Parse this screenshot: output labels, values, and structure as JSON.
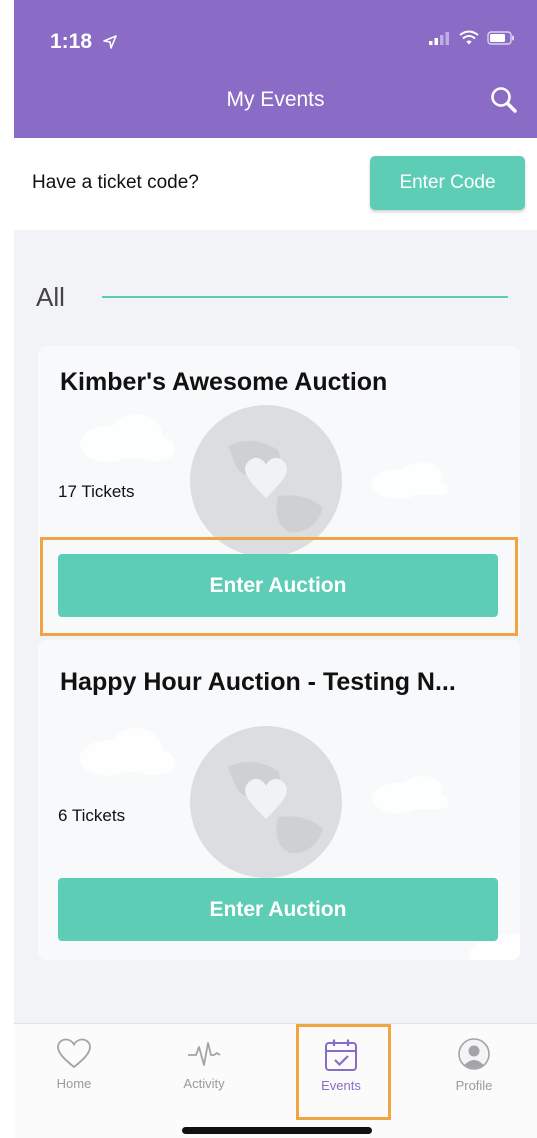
{
  "status_bar": {
    "time": "1:18"
  },
  "header": {
    "title": "My Events"
  },
  "ticket_prompt": {
    "label": "Have a ticket code?",
    "button": "Enter Code"
  },
  "section": {
    "label": "All"
  },
  "events": [
    {
      "title": "Kimber's Awesome Auction",
      "tickets": "17 Tickets",
      "button": "Enter Auction"
    },
    {
      "title": "Happy Hour Auction - Testing N...",
      "tickets": "6 Tickets",
      "button": "Enter Auction"
    }
  ],
  "tabs": [
    {
      "label": "Home",
      "icon": "heart-icon"
    },
    {
      "label": "Activity",
      "icon": "pulse-icon"
    },
    {
      "label": "Events",
      "icon": "calendar-check-icon",
      "active": true
    },
    {
      "label": "Profile",
      "icon": "user-icon"
    }
  ],
  "colors": {
    "header": "#8a6cc7",
    "accent": "#5ecdb6",
    "highlight": "#f0a443",
    "active_tab": "#8a6cc7"
  }
}
